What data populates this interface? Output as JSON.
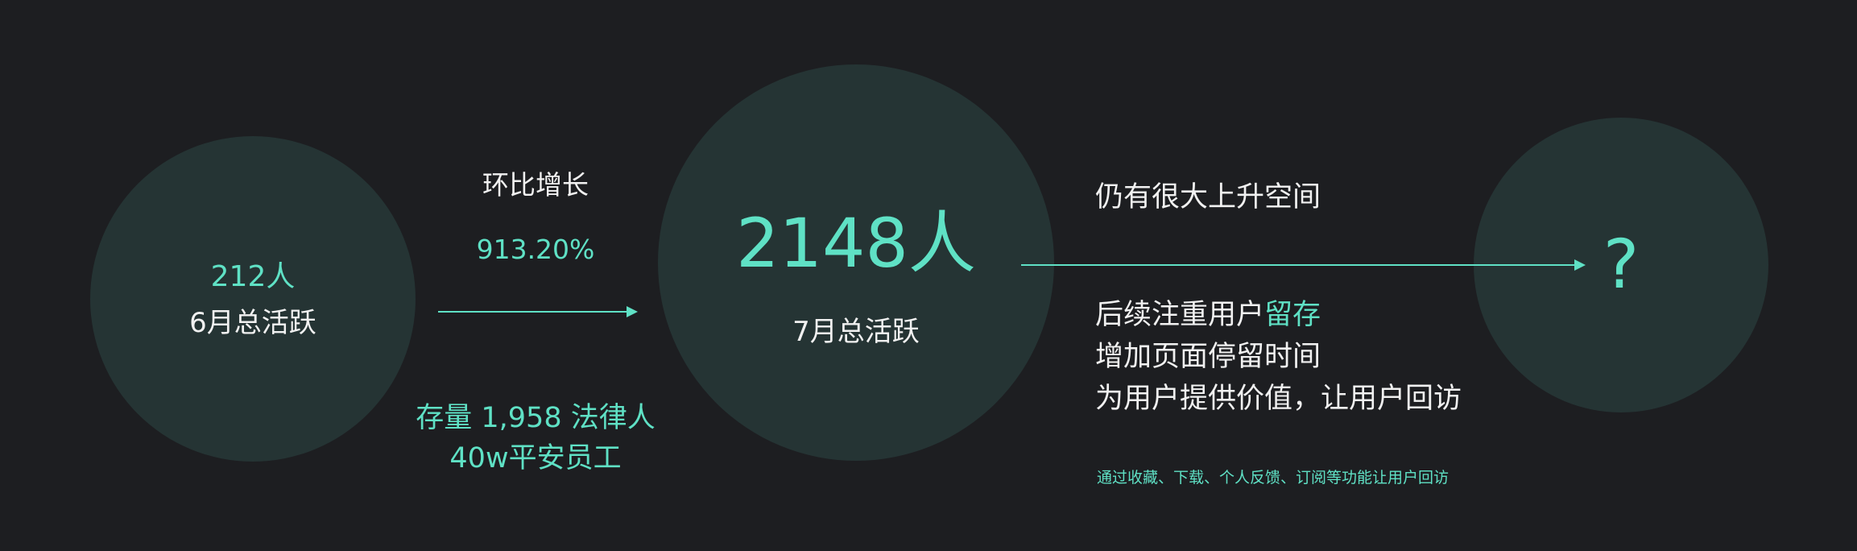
{
  "june": {
    "value": "212人",
    "label": "6月总活跃"
  },
  "growth": {
    "title": "环比增长",
    "value": "913.20%"
  },
  "stock": {
    "line1": "存量 1,958 法律人",
    "line2": "40w平安员工"
  },
  "july": {
    "value": "2148人",
    "label": "7月总活跃"
  },
  "future": {
    "symbol": "?",
    "headline": "仍有很大上升空间",
    "line1_prefix": "后续注重用户",
    "line1_highlight": "留存",
    "line2": "增加页面停留时间",
    "line3": "为用户提供价值，让用户回访",
    "note": "通过收藏、下载、个人反馈、订阅等功能让用户回访"
  },
  "colors": {
    "background": "#1d1e21",
    "circle": "#253434",
    "accent": "#5fe1c5",
    "text": "#f1f1f1"
  }
}
